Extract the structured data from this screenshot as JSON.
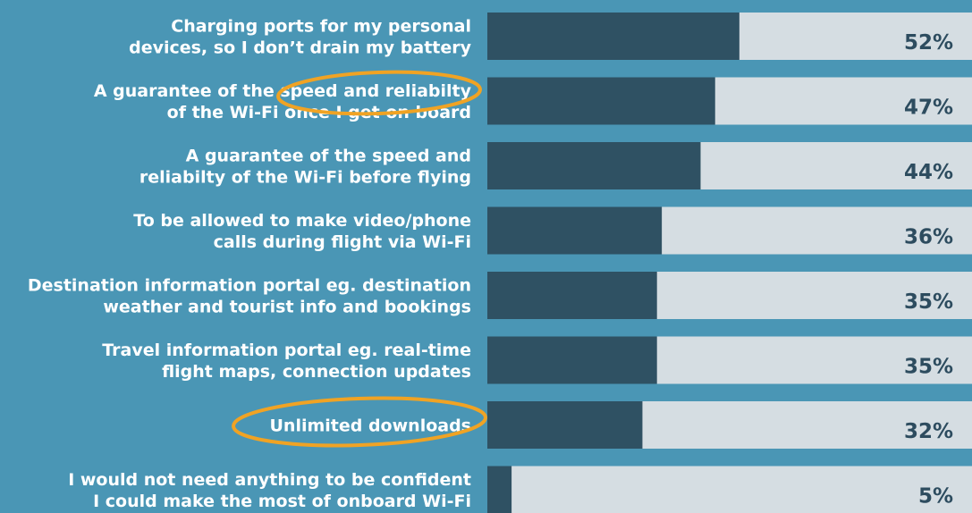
{
  "chart_data": {
    "type": "bar",
    "orientation": "horizontal",
    "categories": [
      [
        "Charging ports for my personal",
        "devices, so I don’t drain my battery"
      ],
      [
        "A guarantee of the speed and reliabilty",
        "of the Wi-Fi once I get on board"
      ],
      [
        "A guarantee of the speed and",
        "reliabilty of the Wi-Fi before flying"
      ],
      [
        "To be allowed to make video/phone",
        "calls during flight via Wi-Fi"
      ],
      [
        "Destination information portal eg. destination",
        "weather and tourist info and bookings"
      ],
      [
        "Travel information portal eg. real-time",
        "flight maps, connection updates"
      ],
      [
        "Unlimited downloads"
      ],
      [
        "I would not need anything to be confident",
        "I could make the most of onboard Wi-Fi"
      ]
    ],
    "values": [
      52,
      47,
      44,
      36,
      35,
      35,
      32,
      5
    ],
    "value_labels": [
      "52%",
      "47%",
      "44%",
      "36%",
      "35%",
      "35%",
      "32%",
      "5%"
    ],
    "value_suffix": "%",
    "highlighted_categories": [
      1,
      6
    ],
    "title": "",
    "xlabel": "",
    "ylabel": "",
    "xlim": [
      0,
      100
    ],
    "grid": false,
    "legend": "none"
  },
  "colors": {
    "background": "#4a96b5",
    "bar_fill": "#2f5163",
    "bar_track": "#d5dde2",
    "label_text": "#ffffff",
    "value_text": "#2d4c5f",
    "highlight_stroke": "#f0a324"
  }
}
